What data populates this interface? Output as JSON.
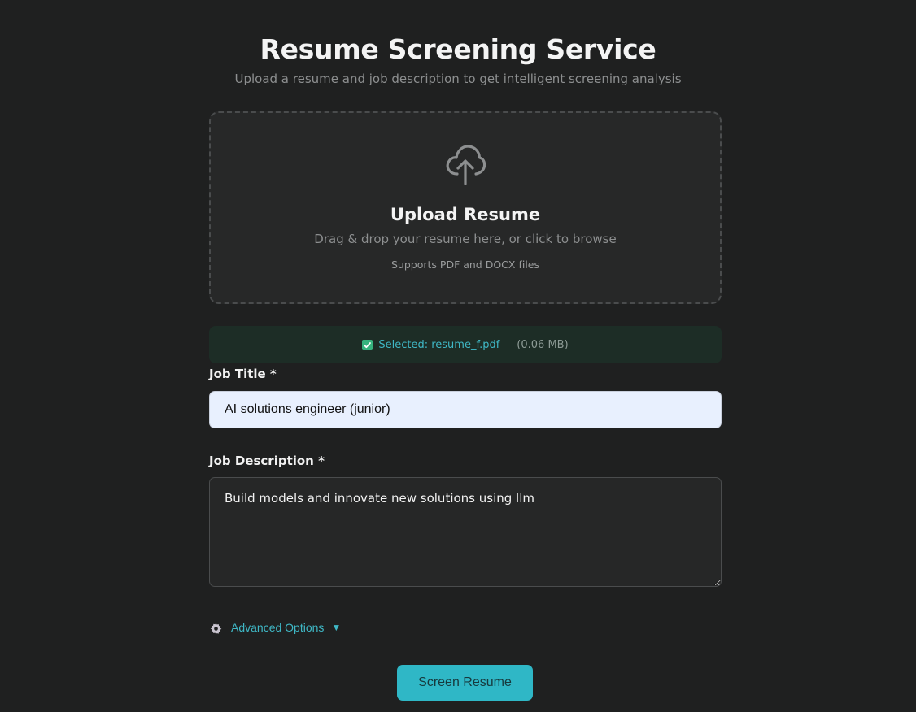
{
  "header": {
    "title": "Resume Screening Service",
    "subtitle": "Upload a resume and job description to get intelligent screening analysis"
  },
  "upload": {
    "icon": "cloud-upload-icon",
    "heading": "Upload Resume",
    "hint": "Drag & drop your resume here, or click to browse",
    "support": "Supports PDF and DOCX files"
  },
  "selected_file": {
    "icon": "checkbox-check-icon",
    "label": "Selected: resume_f.pdf",
    "size": "(0.06 MB)"
  },
  "form": {
    "job_title_label": "Job Title *",
    "job_title_value": "AI solutions engineer (junior)",
    "job_description_label": "Job Description *",
    "job_description_value": "Build models and innovate new solutions using llm"
  },
  "advanced": {
    "icon": "gear-icon",
    "label": "Advanced Options",
    "chevron": "▼"
  },
  "actions": {
    "screen_label": "Screen Resume"
  },
  "colors": {
    "background": "#1f2020",
    "accent": "#2fb7c6",
    "selected_bg": "#1d2d26",
    "check_green": "#36b37e"
  }
}
